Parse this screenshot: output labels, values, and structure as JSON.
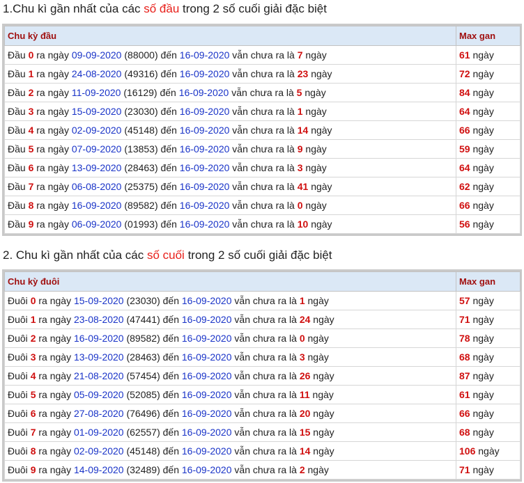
{
  "section1": {
    "title_prefix": "1.Chu kì gần nhất của các ",
    "title_highlight": "số đầu",
    "title_suffix": " trong 2 số cuối giải đặc biệt",
    "col_cycle": "Chu kỳ đầu",
    "col_max": "Max gan",
    "rows": [
      {
        "label": "Đầu",
        "digit": "0",
        "date": "09-09-2020",
        "code": "(88000)",
        "end": "16-09-2020",
        "days": "7",
        "max": "61"
      },
      {
        "label": "Đầu",
        "digit": "1",
        "date": "24-08-2020",
        "code": "(49316)",
        "end": "16-09-2020",
        "days": "23",
        "max": "72"
      },
      {
        "label": "Đầu",
        "digit": "2",
        "date": "11-09-2020",
        "code": "(16129)",
        "end": "16-09-2020",
        "days": "5",
        "max": "84"
      },
      {
        "label": "Đầu",
        "digit": "3",
        "date": "15-09-2020",
        "code": "(23030)",
        "end": "16-09-2020",
        "days": "1",
        "max": "64"
      },
      {
        "label": "Đầu",
        "digit": "4",
        "date": "02-09-2020",
        "code": "(45148)",
        "end": "16-09-2020",
        "days": "14",
        "max": "66"
      },
      {
        "label": "Đầu",
        "digit": "5",
        "date": "07-09-2020",
        "code": "(13853)",
        "end": "16-09-2020",
        "days": "9",
        "max": "59"
      },
      {
        "label": "Đầu",
        "digit": "6",
        "date": "13-09-2020",
        "code": "(28463)",
        "end": "16-09-2020",
        "days": "3",
        "max": "64"
      },
      {
        "label": "Đầu",
        "digit": "7",
        "date": "06-08-2020",
        "code": "(25375)",
        "end": "16-09-2020",
        "days": "41",
        "max": "62"
      },
      {
        "label": "Đầu",
        "digit": "8",
        "date": "16-09-2020",
        "code": "(89582)",
        "end": "16-09-2020",
        "days": "0",
        "max": "66"
      },
      {
        "label": "Đầu",
        "digit": "9",
        "date": "06-09-2020",
        "code": "(01993)",
        "end": "16-09-2020",
        "days": "10",
        "max": "56"
      }
    ]
  },
  "section2": {
    "title_prefix": "2. Chu kì gần nhất của các ",
    "title_highlight": "số cuối",
    "title_suffix": " trong 2 số cuối giải đặc biệt",
    "col_cycle": "Chu kỳ đuôi",
    "col_max": "Max gan",
    "rows": [
      {
        "label": "Đuôi",
        "digit": "0",
        "date": "15-09-2020",
        "code": "(23030)",
        "end": "16-09-2020",
        "days": "1",
        "max": "57"
      },
      {
        "label": "Đuôi",
        "digit": "1",
        "date": "23-08-2020",
        "code": "(47441)",
        "end": "16-09-2020",
        "days": "24",
        "max": "71"
      },
      {
        "label": "Đuôi",
        "digit": "2",
        "date": "16-09-2020",
        "code": "(89582)",
        "end": "16-09-2020",
        "days": "0",
        "max": "78"
      },
      {
        "label": "Đuôi",
        "digit": "3",
        "date": "13-09-2020",
        "code": "(28463)",
        "end": "16-09-2020",
        "days": "3",
        "max": "68"
      },
      {
        "label": "Đuôi",
        "digit": "4",
        "date": "21-08-2020",
        "code": "(57454)",
        "end": "16-09-2020",
        "days": "26",
        "max": "87"
      },
      {
        "label": "Đuôi",
        "digit": "5",
        "date": "05-09-2020",
        "code": "(52085)",
        "end": "16-09-2020",
        "days": "11",
        "max": "61"
      },
      {
        "label": "Đuôi",
        "digit": "6",
        "date": "27-08-2020",
        "code": "(76496)",
        "end": "16-09-2020",
        "days": "20",
        "max": "66"
      },
      {
        "label": "Đuôi",
        "digit": "7",
        "date": "01-09-2020",
        "code": "(62557)",
        "end": "16-09-2020",
        "days": "15",
        "max": "68"
      },
      {
        "label": "Đuôi",
        "digit": "8",
        "date": "02-09-2020",
        "code": "(45148)",
        "end": "16-09-2020",
        "days": "14",
        "max": "106"
      },
      {
        "label": "Đuôi",
        "digit": "9",
        "date": "14-09-2020",
        "code": "(32489)",
        "end": "16-09-2020",
        "days": "2",
        "max": "71"
      }
    ]
  },
  "text": {
    "ra_ngay": "ra ngày",
    "den": "đến",
    "van_chua": "vẫn chưa ra là",
    "ngay": "ngày"
  },
  "colors": {
    "highlight": "#e8201b",
    "number_red": "#d01010",
    "date_blue": "#1a34c8",
    "header_bg": "#dbe8f6"
  }
}
